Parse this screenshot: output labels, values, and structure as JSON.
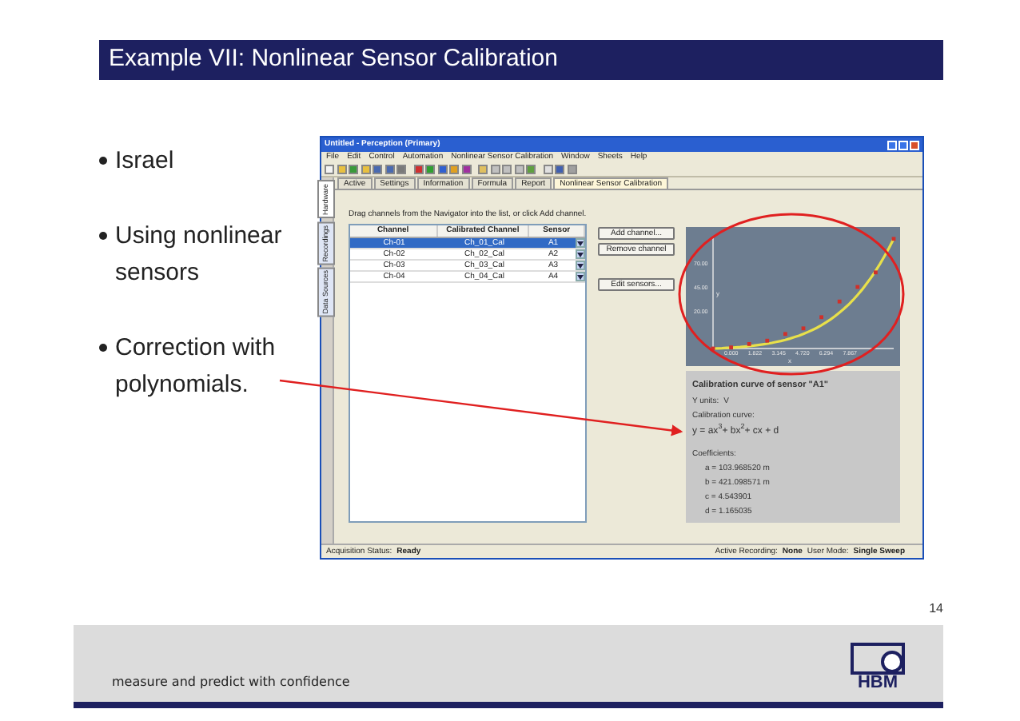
{
  "slide": {
    "title": "Example VII: Nonlinear Sensor Calibration",
    "bullets": [
      "Israel",
      "Using nonlinear sensors",
      "Correction with polynomials."
    ],
    "page_number": "14"
  },
  "window": {
    "title": "Untitled - Perception (Primary)"
  },
  "menu": [
    "File",
    "Edit",
    "Control",
    "Automation",
    "Nonlinear Sensor Calibration",
    "Window",
    "Sheets",
    "Help"
  ],
  "side_tabs": [
    {
      "label": "Hardware",
      "selected": true
    },
    {
      "label": "Recordings",
      "selected": false
    },
    {
      "label": "Data Sources",
      "selected": false
    }
  ],
  "tabs": [
    {
      "label": "Active",
      "selected": false
    },
    {
      "label": "Settings",
      "selected": false
    },
    {
      "label": "Information",
      "selected": false
    },
    {
      "label": "Formula",
      "selected": false
    },
    {
      "label": "Report",
      "selected": false
    },
    {
      "label": "Nonlinear Sensor Calibration",
      "selected": true
    }
  ],
  "instruction": "Drag channels from the Navigator into the list, or click Add channel.",
  "table": {
    "columns": [
      "Channel",
      "Calibrated Channel",
      "Sensor"
    ],
    "rows": [
      {
        "channel": "Ch-01",
        "calibrated": "Ch_01_Cal",
        "sensor": "A1",
        "selected": true
      },
      {
        "channel": "Ch-02",
        "calibrated": "Ch_02_Cal",
        "sensor": "A2",
        "selected": false
      },
      {
        "channel": "Ch-03",
        "calibrated": "Ch_03_Cal",
        "sensor": "A3",
        "selected": false
      },
      {
        "channel": "Ch-04",
        "calibrated": "Ch_04_Cal",
        "sensor": "A4",
        "selected": false
      }
    ]
  },
  "buttons": [
    "Add channel...",
    "Remove channel",
    "Edit sensors..."
  ],
  "chart": {
    "y_ticks": [
      "70.00",
      "45.00",
      "20.00"
    ],
    "x_ticks": [
      "0.000",
      "1.822",
      "3.145",
      "4.720",
      "6.294",
      "7.867"
    ],
    "ylabel": "y",
    "xlabel": "x"
  },
  "info": {
    "heading": "Calibration curve of sensor \"A1\"",
    "units_label": "Y units:",
    "units": "V",
    "curve_label": "Calibration curve:",
    "formula": "y =  ax$^{3}$+ bx$^{2}$+ cx + d",
    "coefficients_label": "Coefficients:",
    "coefficients": [
      "a = 103.968520 m",
      "b = 421.098571 m",
      "c = 4.543901",
      "d = 1.165035"
    ]
  },
  "status_bar": {
    "acq_label": "Acquisition Status:",
    "acq": "Ready",
    "rec_label": "Active Recording:",
    "rec": "None",
    "mode_label": "User Mode:",
    "mode": "Single Sweep"
  },
  "footer": {
    "tagline": "measure and predict with confidence",
    "logo": "HBM"
  }
}
